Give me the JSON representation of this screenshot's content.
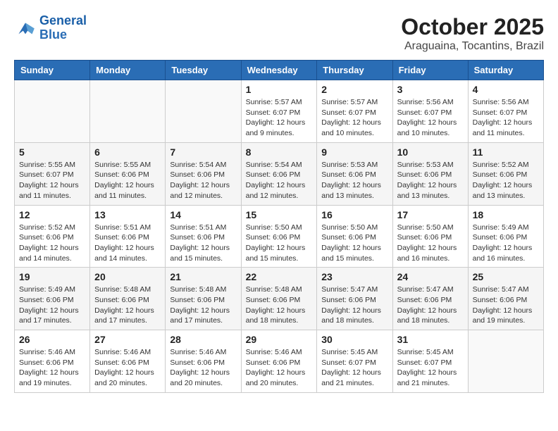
{
  "header": {
    "logo": {
      "line1": "General",
      "line2": "Blue"
    },
    "month": "October 2025",
    "location": "Araguaina, Tocantins, Brazil"
  },
  "weekdays": [
    "Sunday",
    "Monday",
    "Tuesday",
    "Wednesday",
    "Thursday",
    "Friday",
    "Saturday"
  ],
  "weeks": [
    [
      {
        "day": "",
        "info": ""
      },
      {
        "day": "",
        "info": ""
      },
      {
        "day": "",
        "info": ""
      },
      {
        "day": "1",
        "info": "Sunrise: 5:57 AM\nSunset: 6:07 PM\nDaylight: 12 hours\nand 9 minutes."
      },
      {
        "day": "2",
        "info": "Sunrise: 5:57 AM\nSunset: 6:07 PM\nDaylight: 12 hours\nand 10 minutes."
      },
      {
        "day": "3",
        "info": "Sunrise: 5:56 AM\nSunset: 6:07 PM\nDaylight: 12 hours\nand 10 minutes."
      },
      {
        "day": "4",
        "info": "Sunrise: 5:56 AM\nSunset: 6:07 PM\nDaylight: 12 hours\nand 11 minutes."
      }
    ],
    [
      {
        "day": "5",
        "info": "Sunrise: 5:55 AM\nSunset: 6:07 PM\nDaylight: 12 hours\nand 11 minutes."
      },
      {
        "day": "6",
        "info": "Sunrise: 5:55 AM\nSunset: 6:06 PM\nDaylight: 12 hours\nand 11 minutes."
      },
      {
        "day": "7",
        "info": "Sunrise: 5:54 AM\nSunset: 6:06 PM\nDaylight: 12 hours\nand 12 minutes."
      },
      {
        "day": "8",
        "info": "Sunrise: 5:54 AM\nSunset: 6:06 PM\nDaylight: 12 hours\nand 12 minutes."
      },
      {
        "day": "9",
        "info": "Sunrise: 5:53 AM\nSunset: 6:06 PM\nDaylight: 12 hours\nand 13 minutes."
      },
      {
        "day": "10",
        "info": "Sunrise: 5:53 AM\nSunset: 6:06 PM\nDaylight: 12 hours\nand 13 minutes."
      },
      {
        "day": "11",
        "info": "Sunrise: 5:52 AM\nSunset: 6:06 PM\nDaylight: 12 hours\nand 13 minutes."
      }
    ],
    [
      {
        "day": "12",
        "info": "Sunrise: 5:52 AM\nSunset: 6:06 PM\nDaylight: 12 hours\nand 14 minutes."
      },
      {
        "day": "13",
        "info": "Sunrise: 5:51 AM\nSunset: 6:06 PM\nDaylight: 12 hours\nand 14 minutes."
      },
      {
        "day": "14",
        "info": "Sunrise: 5:51 AM\nSunset: 6:06 PM\nDaylight: 12 hours\nand 15 minutes."
      },
      {
        "day": "15",
        "info": "Sunrise: 5:50 AM\nSunset: 6:06 PM\nDaylight: 12 hours\nand 15 minutes."
      },
      {
        "day": "16",
        "info": "Sunrise: 5:50 AM\nSunset: 6:06 PM\nDaylight: 12 hours\nand 15 minutes."
      },
      {
        "day": "17",
        "info": "Sunrise: 5:50 AM\nSunset: 6:06 PM\nDaylight: 12 hours\nand 16 minutes."
      },
      {
        "day": "18",
        "info": "Sunrise: 5:49 AM\nSunset: 6:06 PM\nDaylight: 12 hours\nand 16 minutes."
      }
    ],
    [
      {
        "day": "19",
        "info": "Sunrise: 5:49 AM\nSunset: 6:06 PM\nDaylight: 12 hours\nand 17 minutes."
      },
      {
        "day": "20",
        "info": "Sunrise: 5:48 AM\nSunset: 6:06 PM\nDaylight: 12 hours\nand 17 minutes."
      },
      {
        "day": "21",
        "info": "Sunrise: 5:48 AM\nSunset: 6:06 PM\nDaylight: 12 hours\nand 17 minutes."
      },
      {
        "day": "22",
        "info": "Sunrise: 5:48 AM\nSunset: 6:06 PM\nDaylight: 12 hours\nand 18 minutes."
      },
      {
        "day": "23",
        "info": "Sunrise: 5:47 AM\nSunset: 6:06 PM\nDaylight: 12 hours\nand 18 minutes."
      },
      {
        "day": "24",
        "info": "Sunrise: 5:47 AM\nSunset: 6:06 PM\nDaylight: 12 hours\nand 18 minutes."
      },
      {
        "day": "25",
        "info": "Sunrise: 5:47 AM\nSunset: 6:06 PM\nDaylight: 12 hours\nand 19 minutes."
      }
    ],
    [
      {
        "day": "26",
        "info": "Sunrise: 5:46 AM\nSunset: 6:06 PM\nDaylight: 12 hours\nand 19 minutes."
      },
      {
        "day": "27",
        "info": "Sunrise: 5:46 AM\nSunset: 6:06 PM\nDaylight: 12 hours\nand 20 minutes."
      },
      {
        "day": "28",
        "info": "Sunrise: 5:46 AM\nSunset: 6:06 PM\nDaylight: 12 hours\nand 20 minutes."
      },
      {
        "day": "29",
        "info": "Sunrise: 5:46 AM\nSunset: 6:06 PM\nDaylight: 12 hours\nand 20 minutes."
      },
      {
        "day": "30",
        "info": "Sunrise: 5:45 AM\nSunset: 6:07 PM\nDaylight: 12 hours\nand 21 minutes."
      },
      {
        "day": "31",
        "info": "Sunrise: 5:45 AM\nSunset: 6:07 PM\nDaylight: 12 hours\nand 21 minutes."
      },
      {
        "day": "",
        "info": ""
      }
    ]
  ]
}
